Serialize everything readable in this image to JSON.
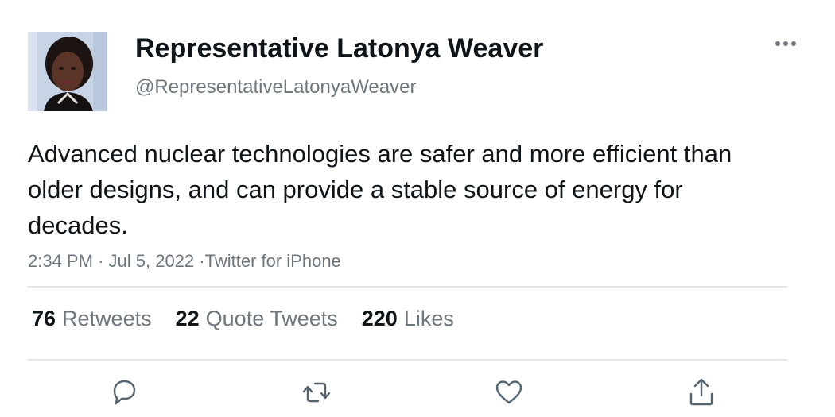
{
  "author": {
    "display_name": "Representative Latonya Weaver",
    "handle": "@RepresentativeLatonyaWeaver"
  },
  "tweet": {
    "text": "Advanced nuclear technologies are safer and more efficient than older designs, and can provide a stable source of energy for decades.",
    "time": "2:34 PM",
    "date": "Jul 5, 2022",
    "source": "Twitter for iPhone",
    "separator": "·"
  },
  "stats": {
    "retweets_count": "76",
    "retweets_label": "Retweets",
    "quotes_count": "22",
    "quotes_label": "Quote Tweets",
    "likes_count": "220",
    "likes_label": "Likes"
  },
  "icons": {
    "more": "more-horizontal-icon",
    "reply": "reply-icon",
    "retweet": "retweet-icon",
    "like": "heart-icon",
    "share": "share-icon"
  },
  "colors": {
    "text_primary": "#0f1419",
    "text_secondary": "#6e767d",
    "divider": "#e1e6ea",
    "icon": "#536471"
  }
}
